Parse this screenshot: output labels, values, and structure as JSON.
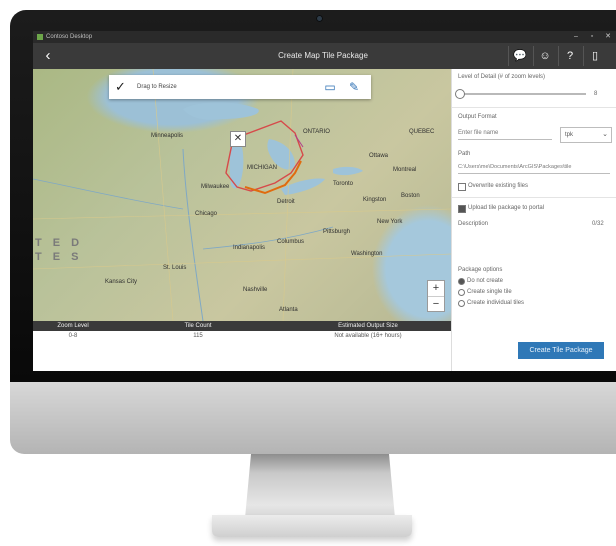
{
  "window": {
    "app_name": "Contoso Desktop",
    "controls": {
      "minimize": "–",
      "maximize": "▫",
      "close": "✕"
    }
  },
  "appbar": {
    "back_icon": "‹",
    "title": "Create Map Tile Package",
    "actions": [
      {
        "name": "chat-icon",
        "glyph": "💬"
      },
      {
        "name": "smiley-icon",
        "glyph": "☺"
      },
      {
        "name": "help-icon",
        "glyph": "?"
      },
      {
        "name": "device-icon",
        "glyph": "▯"
      }
    ]
  },
  "map": {
    "toolbar": {
      "label": "Drag to Resize",
      "check_icon": "✓",
      "rectangle_tool": "▭",
      "freehand_tool": "✎"
    },
    "clear_icon": "✕",
    "zoom_in": "+",
    "zoom_out": "−",
    "state_labels": [
      "T E D",
      "T E S"
    ],
    "place_labels": [
      "Minneapolis",
      "Milwaukee",
      "Chicago",
      "MICHIGAN",
      "Detroit",
      "Toronto",
      "Ottawa",
      "Indianapolis",
      "Columbus",
      "Pittsburgh",
      "St. Louis",
      "Kansas City",
      "Nashville",
      "Atlanta",
      "Washington",
      "New York",
      "Boston",
      "Montreal",
      "ONTARIO",
      "QUEBEC",
      "Kingston"
    ]
  },
  "result_table": {
    "columns": [
      "Zoom Level",
      "Tile Count",
      "Estimated Output Size"
    ],
    "row": [
      "0-8",
      "115",
      "Not available (16+ hours)"
    ]
  },
  "panel": {
    "level_of_detail_label": "Level of Detail (# of zoom levels)",
    "slider_min": "0",
    "slider_max": "8",
    "slider_value": 0,
    "output_section_label": "Output Format",
    "file_name_placeholder": "Enter file name",
    "format_value": "tpk",
    "path_label": "Path",
    "path_value": "C:\\Users\\me\\Documents\\ArcGIS\\Packages\\tile",
    "overwrite_label": "Overwrite existing files",
    "include_label": "Upload tile package to portal",
    "description_label": "Description",
    "description_count": "0/32",
    "options_label": "Package options",
    "radio_options": [
      "Do not create",
      "Create single tile",
      "Create individual tiles"
    ],
    "radio_selected": 0,
    "create_button": "Create Tile Package"
  }
}
